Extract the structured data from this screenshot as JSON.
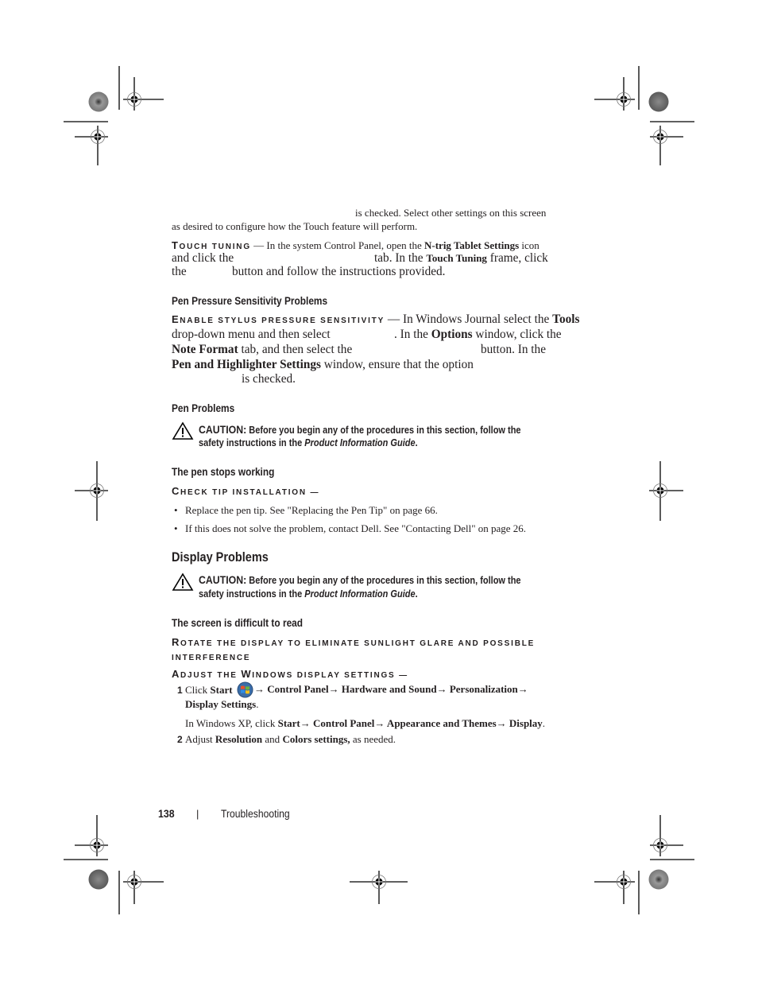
{
  "page": {
    "touch_settings_tail": {
      "line1": "is checked. Select other settings on this screen",
      "line2": "as desired to configure how the Touch feature will perform."
    },
    "touch_tuning": {
      "heading_first": "T",
      "heading_rest": "ouch tuning",
      "dash": " — ",
      "line1_a": "In the system Control Panel, open the ",
      "line1_b": "N-trig Tablet Settings",
      "line1_c": " icon",
      "line2_a": "and click the",
      "line2_b": "tab. In the ",
      "line2_c": "Touch Tuning",
      "line2_d": " frame, click",
      "line3_a": "the",
      "line3_b": "button and follow the instructions provided."
    },
    "pen_pressure": {
      "title": "Pen Pressure Sensitivity Problems",
      "heading_first": "E",
      "heading_rest": "nable stylus pressure sensitivity",
      "dash": " — ",
      "line1_a": "In Windows Journal select the ",
      "line1_b": "Tools",
      "line2_a": "drop-down menu and then select",
      "line2_b": ". In the ",
      "line2_c": "Options",
      "line2_d": " window, click the",
      "line3_a": "Note Format",
      "line3_b": " tab, and then select the",
      "line3_c": "button. In the",
      "line4_a": "Pen and Highlighter Settings",
      "line4_b": " window, ensure that the option",
      "line5": "is checked."
    },
    "pen_problems": {
      "title": "Pen Problems",
      "caution_label": "CAUTION:",
      "caution_text1": " Before you begin any of the procedures in this section, follow the",
      "caution_text2a": "safety instructions in the ",
      "caution_text2b": "Product Information Guide",
      "caution_text2c": "."
    },
    "pen_stops": {
      "title": "The pen stops working",
      "heading_first": "C",
      "heading_rest": "heck tip installation",
      "dash": " —",
      "bullets": [
        "Replace the pen tip. See \"Replacing the Pen Tip\" on page 66.",
        "If this does not solve the problem, contact Dell. See \"Contacting Dell\" on page 26."
      ]
    },
    "display_problems": {
      "title": "Display Problems",
      "caution_label": "CAUTION:",
      "caution_text1": " Before you begin any of the procedures in this section, follow the",
      "caution_text2a": "safety instructions in the ",
      "caution_text2b": "Product Information Guide",
      "caution_text2c": "."
    },
    "screen_difficult": {
      "title": "The screen is difficult to read",
      "rotate_first": "R",
      "rotate_rest_line1": "otate the display to eliminate sunlight glare and possible",
      "rotate_line2": "interference",
      "adjust_first": "A",
      "adjust_rest1": "djust the ",
      "adjust_w": "W",
      "adjust_rest2": "indows display settings",
      "adjust_dash": " —",
      "steps": [
        {
          "num": "1",
          "line1_a": "Click ",
          "line1_b": "Start",
          "line1_c": "→ Control Panel→ Hardware and Sound→ Personalization→",
          "line2": "Display Settings",
          "line2_end": ".",
          "note_a": "In Windows XP, click ",
          "note_b": "Start→ Control Panel→ Appearance and Themes→ Display",
          "note_c": "."
        },
        {
          "num": "2",
          "text_a": "Adjust ",
          "text_b": "Resolution",
          "text_c": " and ",
          "text_d": "Colors settings,",
          "text_e": " as needed."
        }
      ]
    },
    "footer": {
      "page_number": "138",
      "separator": "|",
      "section": "Troubleshooting"
    }
  }
}
